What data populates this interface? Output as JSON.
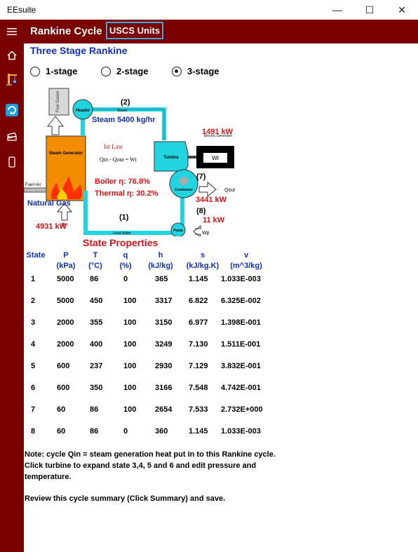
{
  "window": {
    "title": "EEsuite",
    "minimize": "—",
    "maximize": "☐",
    "close": "✕"
  },
  "header": {
    "title": "Rankine Cycle",
    "units_button": "USCS Units"
  },
  "sidebar": {
    "icons": [
      "menu-icon",
      "home-icon",
      "crane-icon",
      "cycle-icon",
      "ticket-icon",
      "phone-icon"
    ]
  },
  "subtitle": "Three Stage Rankine",
  "stages": [
    {
      "label": "1-stage",
      "checked": false
    },
    {
      "label": "2-stage",
      "checked": false
    },
    {
      "label": "3-stage",
      "checked": true
    }
  ],
  "diagram": {
    "flue_gases": "Flue Gases",
    "steam_generator": "Steam Generator",
    "fuel_air": "Fuel+Air",
    "header": "Header",
    "steam_pipe": "Steam",
    "turbine": "Turbine",
    "electric_generator": "Electric Generator",
    "wt": "Wt",
    "condenser": "Condenser",
    "qout": "Qout",
    "pump": "Pump",
    "wp": "Wp",
    "feed_water": "Feed Water",
    "qin": "Qin",
    "first_law": "Ist Law",
    "equation": "Qin - Qout = Wt",
    "state_2": "(2)",
    "state_7": "(7)",
    "state_8": "(8)",
    "state_1": "(1)",
    "steam_flow": "Steam 5400 kg/hr",
    "turbine_power": "1491 kW",
    "boiler_eff": "Boiler η: 76.8%",
    "thermal_eff": "Thermal η: 30.2%",
    "condenser_heat": "3441 kW",
    "pump_power": "11 kW",
    "fuel": "Natural Gas",
    "heat_in": "4931 kW"
  },
  "table": {
    "title": "State Properties",
    "headers": [
      {
        "name": "State",
        "unit": ""
      },
      {
        "name": "P",
        "unit": "(kPa)"
      },
      {
        "name": "T",
        "unit": "(°C)"
      },
      {
        "name": "q",
        "unit": "(%)"
      },
      {
        "name": "h",
        "unit": "(kJ/kg)"
      },
      {
        "name": "s",
        "unit": "(kJ/kg.K)"
      },
      {
        "name": "v",
        "unit": "(m^3/kg)"
      }
    ],
    "rows": [
      [
        "1",
        "5000",
        "86",
        "0",
        "365",
        "1.145",
        "1.033E-003"
      ],
      [
        "2",
        "5000",
        "450",
        "100",
        "3317",
        "6.822",
        "6.325E-002"
      ],
      [
        "3",
        "2000",
        "355",
        "100",
        "3150",
        "6.977",
        "1.398E-001"
      ],
      [
        "4",
        "2000",
        "400",
        "100",
        "3249",
        "7.130",
        "1.511E-001"
      ],
      [
        "5",
        "600",
        "237",
        "100",
        "2930",
        "7.129",
        "3.832E-001"
      ],
      [
        "6",
        "600",
        "350",
        "100",
        "3166",
        "7.548",
        "4.742E-001"
      ],
      [
        "7",
        "60",
        "86",
        "100",
        "2654",
        "7.533",
        "2.732E+000"
      ],
      [
        "8",
        "60",
        "86",
        "0",
        "360",
        "1.145",
        "1.033E-003"
      ]
    ]
  },
  "notes": {
    "note1": "Note: cycle Qin = steam generation heat put in to this Rankine cycle.  Click turbine to expand state 3,4, 5 and 6 and edit pressure and temperature.",
    "note2": "Review this cycle summary (Click Summary) and save."
  }
}
